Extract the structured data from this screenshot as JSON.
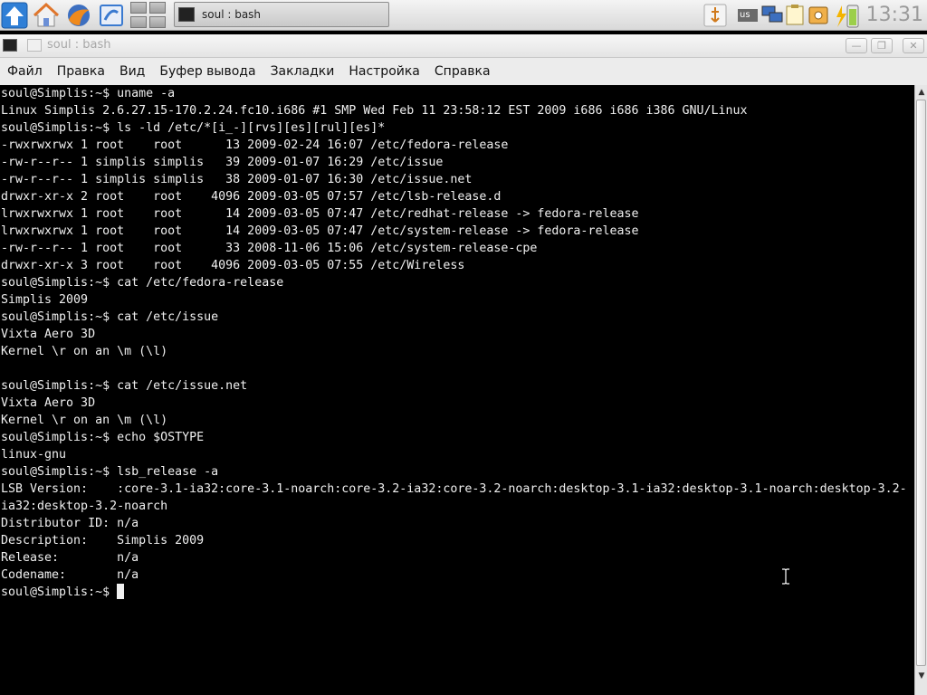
{
  "taskbar": {
    "launchers": [
      {
        "icon": "arrow-up-icon",
        "color": "#2f7fd6"
      },
      {
        "icon": "home-icon",
        "color": "#e0762c"
      },
      {
        "icon": "browser-icon",
        "color": "#f08a1c"
      },
      {
        "icon": "app-icon",
        "color": "#3a7ad0"
      }
    ],
    "task_label": "soul : bash",
    "clock": "13:31",
    "tray_keyboard": "us"
  },
  "window": {
    "title": "soul : bash",
    "buttons": {
      "minimize": "—",
      "maximize": "❐",
      "close": "✕"
    }
  },
  "menu": {
    "items": [
      "Файл",
      "Правка",
      "Вид",
      "Буфер вывода",
      "Закладки",
      "Настройка",
      "Справка"
    ]
  },
  "terminal": {
    "lines": [
      "soul@Simplis:~$ uname -a",
      "Linux Simplis 2.6.27.15-170.2.24.fc10.i686 #1 SMP Wed Feb 11 23:58:12 EST 2009 i686 i686 i386 GNU/Linux",
      "soul@Simplis:~$ ls -ld /etc/*[i_-][rvs][es][rul][es]*",
      "-rwxrwxrwx 1 root    root      13 2009-02-24 16:07 /etc/fedora-release",
      "-rw-r--r-- 1 simplis simplis   39 2009-01-07 16:29 /etc/issue",
      "-rw-r--r-- 1 simplis simplis   38 2009-01-07 16:30 /etc/issue.net",
      "drwxr-xr-x 2 root    root    4096 2009-03-05 07:57 /etc/lsb-release.d",
      "lrwxrwxrwx 1 root    root      14 2009-03-05 07:47 /etc/redhat-release -> fedora-release",
      "lrwxrwxrwx 1 root    root      14 2009-03-05 07:47 /etc/system-release -> fedora-release",
      "-rw-r--r-- 1 root    root      33 2008-11-06 15:06 /etc/system-release-cpe",
      "drwxr-xr-x 3 root    root    4096 2009-03-05 07:55 /etc/Wireless",
      "soul@Simplis:~$ cat /etc/fedora-release",
      "Simplis 2009",
      "soul@Simplis:~$ cat /etc/issue",
      "Vixta Aero 3D",
      "Kernel \\r on an \\m (\\l)",
      "",
      "soul@Simplis:~$ cat /etc/issue.net",
      "Vixta Aero 3D",
      "Kernel \\r on an \\m (\\l)",
      "soul@Simplis:~$ echo $OSTYPE",
      "linux-gnu",
      "soul@Simplis:~$ lsb_release -a",
      "LSB Version:    :core-3.1-ia32:core-3.1-noarch:core-3.2-ia32:core-3.2-noarch:desktop-3.1-ia32:desktop-3.1-noarch:desktop-3.2-",
      "ia32:desktop-3.2-noarch",
      "Distributor ID: n/a",
      "Description:    Simplis 2009",
      "Release:        n/a",
      "Codename:       n/a",
      "soul@Simplis:~$ "
    ]
  },
  "colors": {
    "terminal_bg": "#000000",
    "terminal_fg": "#f0f0f0",
    "menubar_bg": "#ececec",
    "clock_fg": "#9a9a9a"
  }
}
